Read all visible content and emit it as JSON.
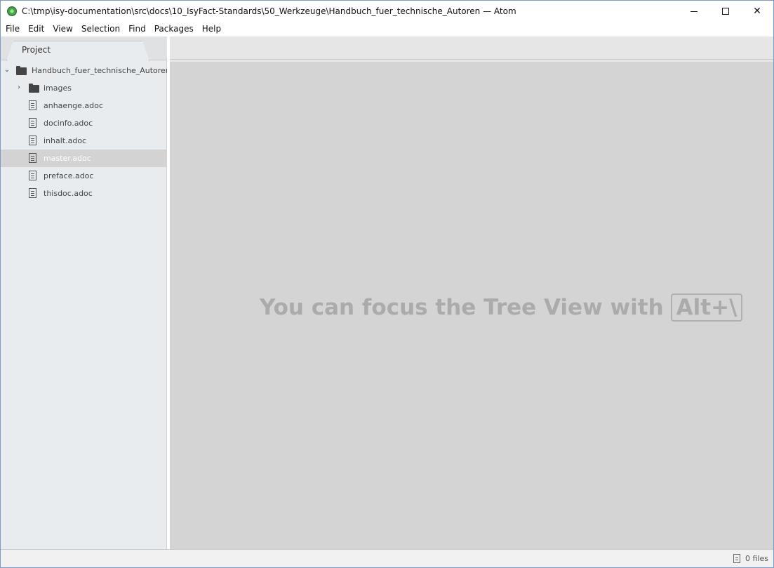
{
  "window": {
    "title": "C:\\tmp\\isy-documentation\\src\\docs\\10_IsyFact-Standards\\50_Werkzeuge\\Handbuch_fuer_technische_Autoren — Atom",
    "close_glyph": "✕"
  },
  "menu": [
    {
      "label": "File"
    },
    {
      "label": "Edit"
    },
    {
      "label": "View"
    },
    {
      "label": "Selection"
    },
    {
      "label": "Find"
    },
    {
      "label": "Packages"
    },
    {
      "label": "Help"
    }
  ],
  "tree": {
    "tab_label": "Project",
    "root": {
      "label": "Handbuch_fuer_technische_Autoren",
      "expanded": true,
      "arrow": "⌄"
    },
    "items": [
      {
        "label": "images",
        "type": "folder",
        "arrow": "›"
      },
      {
        "label": "anhaenge.adoc",
        "type": "file"
      },
      {
        "label": "docinfo.adoc",
        "type": "file"
      },
      {
        "label": "inhalt.adoc",
        "type": "file"
      },
      {
        "label": "master.adoc",
        "type": "file",
        "selected": true
      },
      {
        "label": "preface.adoc",
        "type": "file"
      },
      {
        "label": "thisdoc.adoc",
        "type": "file"
      }
    ]
  },
  "editor": {
    "hint_text": "You can focus the Tree View with",
    "shortcut": "Alt+\\"
  },
  "status": {
    "files": "0 files"
  }
}
